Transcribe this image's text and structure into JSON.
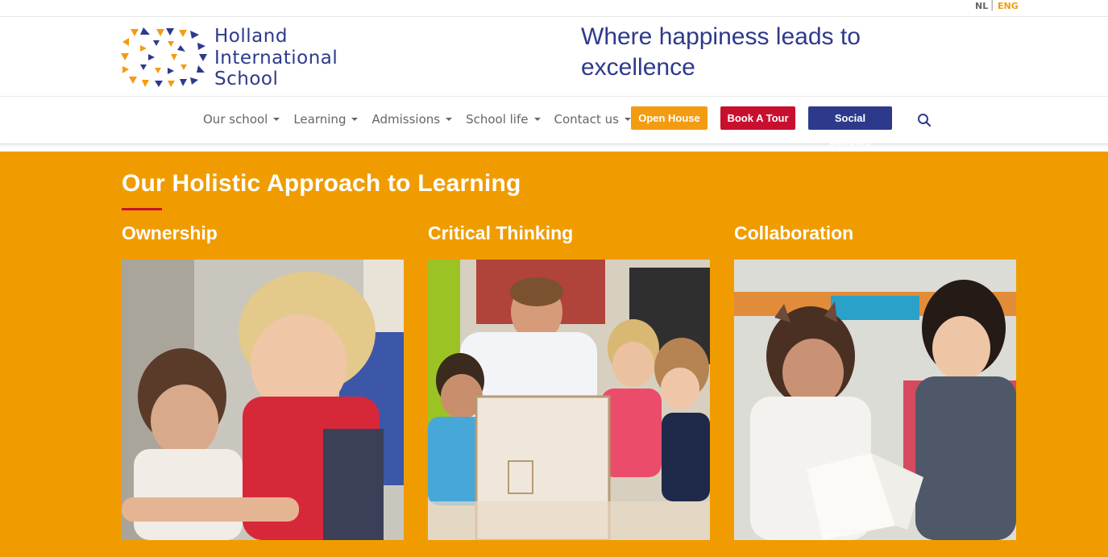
{
  "lang": {
    "nl": "NL",
    "sep": "|",
    "eng": "ENG"
  },
  "logo": {
    "line1": "Holland",
    "line2": "International",
    "line3": "School"
  },
  "tagline": {
    "line1": "Where happiness leads to",
    "line2": "excellence"
  },
  "nav": {
    "items": [
      {
        "label": "Our school"
      },
      {
        "label": "Learning"
      },
      {
        "label": "Admissions"
      },
      {
        "label": "School life"
      },
      {
        "label": "Contact us"
      }
    ],
    "buttons": {
      "open_house": "Open House",
      "book_tour": "Book A Tour",
      "social_schools": "Social Schools"
    },
    "search_icon": "search-icon"
  },
  "colors": {
    "brand_blue": "#2d3a8c",
    "orange": "#f09c00",
    "red": "#c8102e"
  },
  "section": {
    "title": "Our Holistic Approach to Learning",
    "columns": [
      {
        "title": "Ownership"
      },
      {
        "title": "Critical Thinking"
      },
      {
        "title": "Collaboration"
      }
    ]
  }
}
